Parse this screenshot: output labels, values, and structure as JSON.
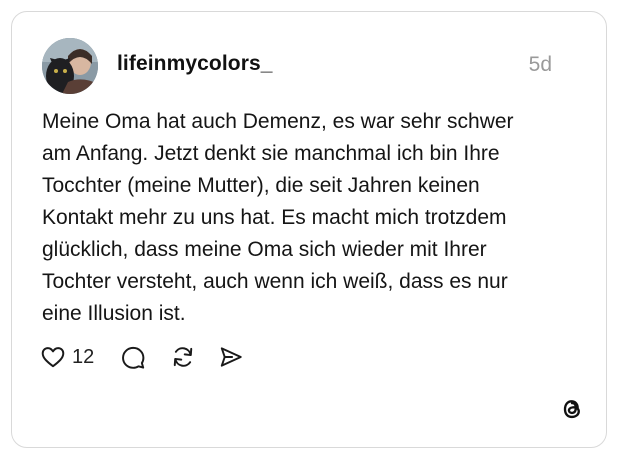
{
  "post": {
    "username": "lifeinmycolors_",
    "time": "5d",
    "text": "Meine Oma hat auch Demenz, es war sehr schwer\nam Anfang. Jetzt denkt sie manchmal ich bin Ihre\nTocchter (meine Mutter), die seit Jahren keinen\nKontakt mehr zu uns hat. Es macht mich trotzdem\nglücklich, dass meine Oma sich wieder mit Ihrer\nTochter versteht, auch wenn ich weiß, dass es nur\neine Illusion ist.",
    "like_count": "12"
  },
  "icons": {
    "like": "heart-icon",
    "reply": "comment-icon",
    "repost": "repost-icon",
    "share": "share-icon",
    "brand": "threads-logo-icon"
  }
}
